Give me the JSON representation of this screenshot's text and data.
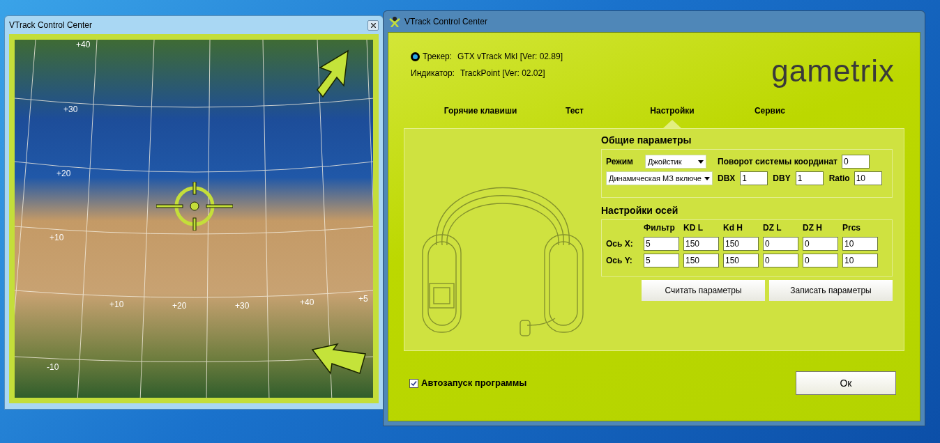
{
  "map_window": {
    "title": "VTrack Control Center",
    "grid_labels": [
      {
        "text": "+40"
      },
      {
        "text": "+30"
      },
      {
        "text": "+20"
      },
      {
        "text": "+10"
      },
      {
        "text": "+10"
      },
      {
        "text": "+20"
      },
      {
        "text": "+30"
      },
      {
        "text": "+40"
      },
      {
        "text": "+5"
      },
      {
        "text": "-10"
      }
    ]
  },
  "main_window": {
    "title": "VTrack Control Center",
    "tracker": {
      "label": "Трекер:",
      "value": "GTX vTrack MkI [Ver: 02.89]",
      "connected": true
    },
    "indicator": {
      "label": "Индикатор:",
      "value": "TrackPoint [Ver: 02.02]"
    },
    "logo": "gametrix",
    "tabs": [
      {
        "label": "Горячие клавиши",
        "selected": false
      },
      {
        "label": "Тест",
        "selected": false
      },
      {
        "label": "Настройки",
        "selected": true
      },
      {
        "label": "Сервис",
        "selected": false
      }
    ],
    "general": {
      "title": "Общие параметры",
      "mode_label": "Режим",
      "mode_value": "Джойстик",
      "rotation_label": "Поворот системы координат",
      "rotation_value": "0",
      "dynamic_value": "Динамическая МЗ включе",
      "dbx_label": "DBX",
      "dbx_value": "1",
      "dby_label": "DBY",
      "dby_value": "1",
      "ratio_label": "Ratio",
      "ratio_value": "10"
    },
    "axes": {
      "title": "Настройки осей",
      "columns": [
        "Фильтр",
        "KD L",
        "Kd H",
        "DZ L",
        "DZ H",
        "Prcs"
      ],
      "rows": [
        {
          "label": "Ось X:",
          "values": [
            "5",
            "150",
            "150",
            "0",
            "0",
            "10"
          ]
        },
        {
          "label": "Ось Y:",
          "values": [
            "5",
            "150",
            "150",
            "0",
            "0",
            "10"
          ]
        }
      ]
    },
    "buttons": [
      "Считать параметры",
      "Записать параметры"
    ],
    "autostart": {
      "label": "Автозапуск программы",
      "checked": true
    },
    "ok": "Ок"
  }
}
